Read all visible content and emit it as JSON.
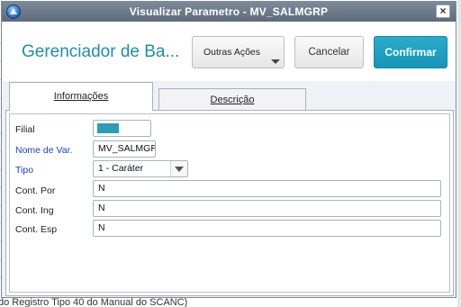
{
  "window": {
    "title": "Visualizar Parametro - MV_SALMGRP",
    "close_glyph": "×"
  },
  "header": {
    "title": "Gerenciador de Ba...",
    "buttons": {
      "outras_acoes": "Outras Ações",
      "cancelar": "Cancelar",
      "confirmar": "Confirmar"
    }
  },
  "tabs": [
    {
      "label": "Informações",
      "active": true
    },
    {
      "label": "Descrição",
      "active": false
    }
  ],
  "form": {
    "filial": {
      "label": "Filial",
      "value": ""
    },
    "nome_var": {
      "label": "Nome de Var.",
      "value": "MV_SALMGRP"
    },
    "tipo": {
      "label": "Tipo",
      "value": "1 - Caráter"
    },
    "cont_por": {
      "label": "Cont. Por",
      "value": "N"
    },
    "cont_ing": {
      "label": "Cont. Ing",
      "value": "N"
    },
    "cont_esp": {
      "label": "Cont. Esp",
      "value": "N"
    }
  },
  "background": {
    "footer_text": "do Registro Tipo 40 do Manual do SCANC)"
  },
  "colors": {
    "accent": "#1e8dad",
    "confirm_button": "#1596b7",
    "required_label": "#1a3fd1",
    "titlebar": "#6b7888"
  }
}
